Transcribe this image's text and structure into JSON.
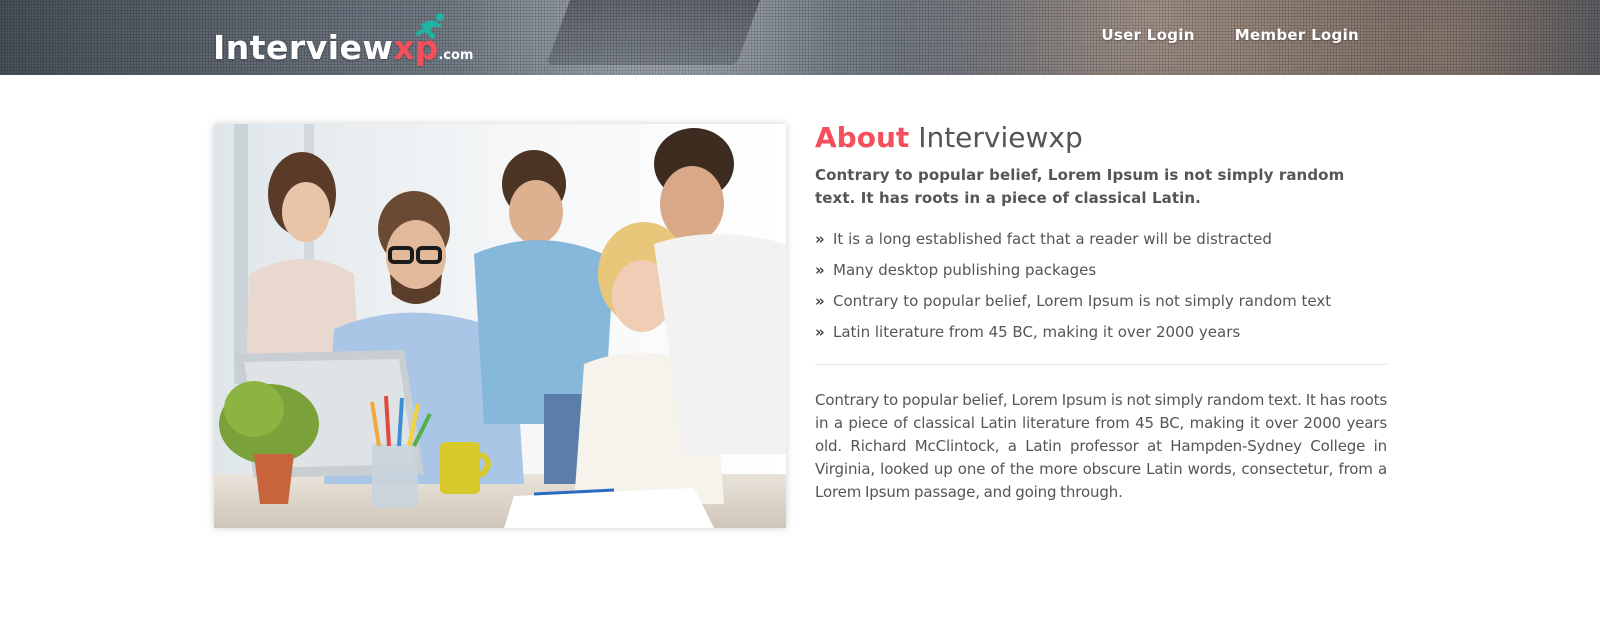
{
  "header": {
    "logo": {
      "main": "Interview",
      "accent": "xp",
      "suffix": ".com"
    },
    "nav": [
      {
        "label": "User Login"
      },
      {
        "label": "Member Login"
      }
    ]
  },
  "about": {
    "title_accent": "About",
    "title_rest": "Interviewxp",
    "lead": "Contrary to popular belief, Lorem Ipsum is not simply random text. It has roots in a piece of classical Latin.",
    "bullets": [
      "It is a long established fact that a reader will be distracted",
      "Many desktop publishing packages",
      "Contrary to popular belief, Lorem Ipsum is not simply random text",
      "Latin literature from 45 BC, making it over 2000 years"
    ],
    "paragraph": "Contrary to popular belief, Lorem Ipsum is not simply random text. It has roots in a piece of classical Latin literature from 45 BC, making it over 2000 years old. Richard McClintock, a Latin professor at Hampden-Sydney College in Virginia, looked up one of the more obscure Latin words, consectetur, from a Lorem Ipsum passage, and going through."
  },
  "icons": {
    "bullet": "double-chevron-right-icon",
    "logo_figure": "running-figure-icon"
  },
  "colors": {
    "accent": "#f44f5c",
    "logo_figure": "#1fb3a3",
    "text": "#555555"
  }
}
